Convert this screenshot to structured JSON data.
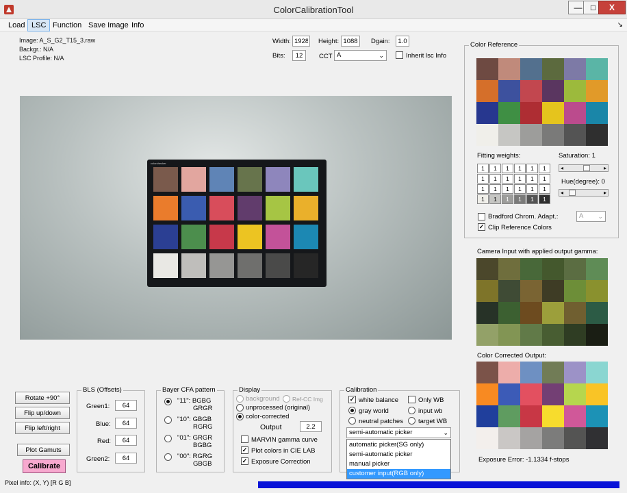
{
  "window": {
    "title": "ColorCalibrationTool",
    "min": "—",
    "max": "□",
    "close": "X"
  },
  "menu": [
    "Load",
    "LSC",
    "Function",
    "Save Image",
    "Info"
  ],
  "menu_arrow": "↘",
  "info": {
    "image": "Image: A_S_G2_T15_3.raw",
    "background": "Backgr.: N/A",
    "lsc_profile": "LSC Profile: N/A"
  },
  "params": {
    "width_label": "Width:",
    "width": "1928",
    "height_label": "Height:",
    "height": "1088",
    "dgain_label": "Dgain:",
    "dgain": "1.0",
    "bits_label": "Bits:",
    "bits": "12",
    "cct_label": "CCT",
    "cct": "A",
    "inherit_label": "Inherit lsc Info"
  },
  "color_reference": {
    "title": "Color Reference",
    "patches": [
      "#6e4a42",
      "#c08a7b",
      "#53708e",
      "#5c6a3e",
      "#7d7aa6",
      "#5ab5a6",
      "#d56f2a",
      "#3d519e",
      "#c2474f",
      "#5a3660",
      "#9cba3c",
      "#e19a29",
      "#27378f",
      "#3f8f44",
      "#ae2d33",
      "#e5c41d",
      "#bb4b8d",
      "#1a86a8",
      "#f0efea",
      "#c6c6c3",
      "#9d9d9b",
      "#7a7a79",
      "#545454",
      "#2f2f2f"
    ]
  },
  "fitting_weights": {
    "title": "Fitting weights:",
    "rows": [
      [
        "1",
        "1",
        "1",
        "1",
        "1",
        "1"
      ],
      [
        "1",
        "1",
        "1",
        "1",
        "1",
        "1"
      ],
      [
        "1",
        "1",
        "1",
        "1",
        "1",
        "1"
      ],
      [
        "1",
        "1",
        "1",
        "1",
        "1",
        "1"
      ]
    ],
    "last_row_bg": [
      "#f0efea",
      "#c6c6c3",
      "#9d9d9b",
      "#7a7a79",
      "#545454",
      "#2f2f2f"
    ],
    "last_row_fg": [
      "#000",
      "#000",
      "#fff",
      "#fff",
      "#fff",
      "#fff"
    ]
  },
  "saturation": {
    "label": "Saturation: 1",
    "value": 0.5
  },
  "hue": {
    "label": "Hue(degree): 0",
    "value": 0.1
  },
  "bradford": {
    "label": "Bradford Chrom. Adapt.:",
    "value": "A",
    "checked": false
  },
  "clip_ref": {
    "label": "Clip Reference Colors",
    "checked": true,
    "mark": "✓"
  },
  "camera_input": {
    "title": "Camera Input with applied output gamma:",
    "patches": [
      "#4b472b",
      "#6f6e3d",
      "#486839",
      "#44582d",
      "#5b6d42",
      "#5f8c56",
      "#7e7429",
      "#3f4b35",
      "#7a6433",
      "#3e3c25",
      "#6d8e38",
      "#8a912e",
      "#273227",
      "#3c6031",
      "#6d4b1f",
      "#9c9f3b",
      "#705f30",
      "#2c5b45",
      "#93a168",
      "#829554",
      "#617a48",
      "#485d32",
      "#2f3d23",
      "#1a1e14"
    ]
  },
  "corrected": {
    "title": "Color Corrected Output:",
    "patches": [
      "#7b5349",
      "#edadaa",
      "#6e90c2",
      "#717c56",
      "#9c92c7",
      "#8ad6d1",
      "#f88a22",
      "#3c5bb7",
      "#e35060",
      "#733f74",
      "#b6d64e",
      "#f9c426",
      "#203f9c",
      "#5f9c60",
      "#c83745",
      "#f7dc2d",
      "#d05899",
      "#1c92b6",
      "#f3efec",
      "#cac7c5",
      "#a5a3a2",
      "#7c7c7b",
      "#545453",
      "#303033"
    ]
  },
  "exposure_error": "Exposure Error: -1.1334 f-stops",
  "buttons": {
    "rotate": "Rotate +90°",
    "flip_ud": "Flip up/down",
    "flip_lr": "Flip left/right",
    "plot_gamuts": "Plot Gamuts",
    "calibrate": "Calibrate"
  },
  "bls": {
    "title": "BLS (Offsets)",
    "green1_label": "Green1:",
    "green1": "64",
    "blue_label": "Blue:",
    "blue": "64",
    "red_label": "Red:",
    "red": "64",
    "green2_label": "Green2:",
    "green2": "64"
  },
  "bayer": {
    "title": "Bayer CFA pattern",
    "options": [
      {
        "line1": "\"11\": BGBG",
        "line2": "GRGR",
        "selected": true
      },
      {
        "line1": "\"10\": GBGB",
        "line2": "RGRG",
        "selected": false
      },
      {
        "line1": "\"01\": GRGR",
        "line2": "BGBG",
        "selected": false
      },
      {
        "line1": "\"00\": RGRG",
        "line2": "GBGB",
        "selected": false
      }
    ]
  },
  "display": {
    "title": "Display",
    "background": "background",
    "ref_cc": "Ref-CC Img",
    "unprocessed": "unprocessed (original)",
    "color_corrected": "color-corrected",
    "output_label": "Output",
    "output": "2.2",
    "marvin": "MARVIN gamma curve",
    "plot_cielab": "Plot colors in CIE LAB",
    "exposure_corr": "Exposure Correction",
    "mark": "✓"
  },
  "calibration": {
    "title": "Calibration",
    "white_balance": "white balance",
    "only_wb": "Only WB",
    "gray_world": "gray world",
    "input_wb": "input wb",
    "neutral_patches": "neutral patches",
    "target_wb": "target WB",
    "picker_value": "semi-automatic picker",
    "picker_options": [
      "automatic picker(SG only)",
      "semi-automatic picker",
      "manual picker",
      "customer input(RGB only)"
    ],
    "mark": "✓",
    "chevron": "⌄"
  },
  "pixel_info": "Pixel info: (X, Y)  [R G B]",
  "chart_board": {
    "logo": "colorchecker",
    "patches": [
      "#7a5a4c",
      "#e2a69f",
      "#5f84b6",
      "#67744c",
      "#8e86bc",
      "#6ac6bc",
      "#ea7c2c",
      "#3a5cb0",
      "#d84d5b",
      "#613c6c",
      "#a6c544",
      "#eab02b",
      "#2b3f93",
      "#4c8e4d",
      "#c7394a",
      "#ecc422",
      "#c35299",
      "#1c88b3",
      "#e9e8e4",
      "#bfbebb",
      "#969694",
      "#6f6f6d",
      "#4a4a49",
      "#262626"
    ]
  }
}
